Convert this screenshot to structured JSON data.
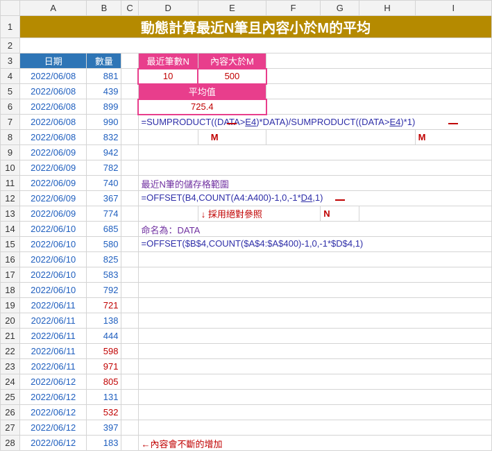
{
  "cols": [
    "A",
    "B",
    "C",
    "D",
    "E",
    "F",
    "G",
    "H",
    "I"
  ],
  "title": "動態計算最近N筆且內容小於M的平均",
  "headers": {
    "date": "日期",
    "qty": "數量",
    "recentN": "最近筆數N",
    "gtM": "內容大於M",
    "avg": "平均值"
  },
  "inputs": {
    "n": "10",
    "m": "500",
    "avg": "725.4"
  },
  "rows": [
    {
      "r": 4,
      "d": "2022/06/08",
      "v": "881",
      "red": false
    },
    {
      "r": 5,
      "d": "2022/06/08",
      "v": "439",
      "red": false
    },
    {
      "r": 6,
      "d": "2022/06/08",
      "v": "899",
      "red": false
    },
    {
      "r": 7,
      "d": "2022/06/08",
      "v": "990",
      "red": false
    },
    {
      "r": 8,
      "d": "2022/06/08",
      "v": "832",
      "red": false
    },
    {
      "r": 9,
      "d": "2022/06/09",
      "v": "942",
      "red": false
    },
    {
      "r": 10,
      "d": "2022/06/09",
      "v": "782",
      "red": false
    },
    {
      "r": 11,
      "d": "2022/06/09",
      "v": "740",
      "red": false
    },
    {
      "r": 12,
      "d": "2022/06/09",
      "v": "367",
      "red": false
    },
    {
      "r": 13,
      "d": "2022/06/09",
      "v": "774",
      "red": false
    },
    {
      "r": 14,
      "d": "2022/06/10",
      "v": "685",
      "red": false
    },
    {
      "r": 15,
      "d": "2022/06/10",
      "v": "580",
      "red": false
    },
    {
      "r": 16,
      "d": "2022/06/10",
      "v": "825",
      "red": false
    },
    {
      "r": 17,
      "d": "2022/06/10",
      "v": "583",
      "red": false
    },
    {
      "r": 18,
      "d": "2022/06/10",
      "v": "792",
      "red": false
    },
    {
      "r": 19,
      "d": "2022/06/11",
      "v": "721",
      "red": true
    },
    {
      "r": 20,
      "d": "2022/06/11",
      "v": "138",
      "red": false
    },
    {
      "r": 21,
      "d": "2022/06/11",
      "v": "444",
      "red": false
    },
    {
      "r": 22,
      "d": "2022/06/11",
      "v": "598",
      "red": true
    },
    {
      "r": 23,
      "d": "2022/06/11",
      "v": "971",
      "red": true
    },
    {
      "r": 24,
      "d": "2022/06/12",
      "v": "805",
      "red": true
    },
    {
      "r": 25,
      "d": "2022/06/12",
      "v": "131",
      "red": false
    },
    {
      "r": 26,
      "d": "2022/06/12",
      "v": "532",
      "red": true
    },
    {
      "r": 27,
      "d": "2022/06/12",
      "v": "397",
      "red": false
    },
    {
      "r": 28,
      "d": "2022/06/12",
      "v": "183",
      "red": false
    }
  ],
  "formula7_a": "=SUMPRODUCT((DATA>",
  "formula7_b": "E4",
  "formula7_c": ")*DATA)/SUMPRODUCT((DATA>",
  "formula7_d": "E4",
  "formula7_e": ")*1)",
  "anno_M": "M",
  "note11": "最近N筆的儲存格範圍",
  "formula12_a": "=OFFSET(B4,COUNT(A4:A400)-1,0,-1*",
  "formula12_b": "D4",
  "formula12_c": ",1)",
  "anno_N": "N",
  "note13": "採用絕對參照",
  "note14": "命名為：DATA",
  "formula15": "=OFFSET($B$4,COUNT($A$4:$A$400)-1,0,-1*$D$4,1)",
  "note28": "←內容會不斷的增加"
}
